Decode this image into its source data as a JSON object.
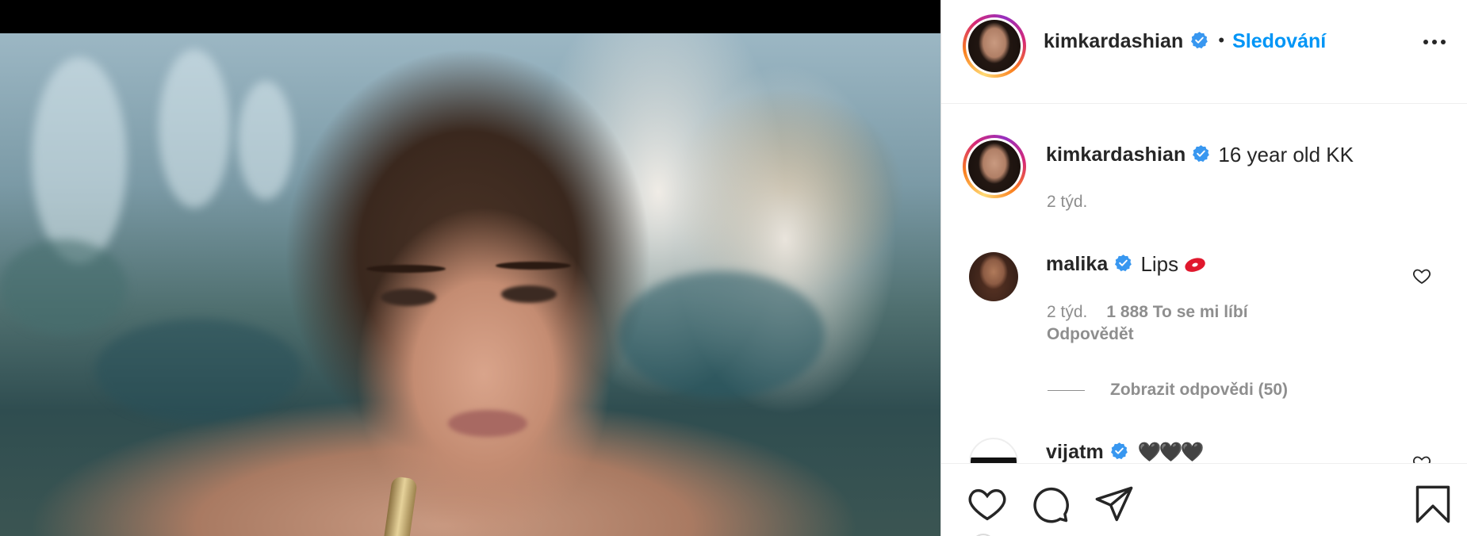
{
  "post": {
    "author": "kimkardashian",
    "follow_label": "Sledování",
    "separator": "•",
    "caption": "16 year old KK",
    "caption_time": "2 týd."
  },
  "comments": [
    {
      "user": "malika",
      "text": "Lips",
      "time": "2 týd.",
      "likes": "1 888 To se mi líbí",
      "reply_label": "Odpovědět",
      "view_replies": "Zobrazit odpovědi (50)"
    },
    {
      "user": "vijatm",
      "text": "🖤🖤🖤"
    }
  ],
  "colors": {
    "accent": "#0095f6",
    "text": "#262626",
    "muted": "#8e8e8e",
    "verified": "#3897f0"
  },
  "icons": {
    "verified": "verified-badge-icon",
    "more": "more-options-icon",
    "like": "heart-icon",
    "comment": "comment-bubble-icon",
    "share": "paper-plane-icon",
    "save": "bookmark-icon"
  }
}
